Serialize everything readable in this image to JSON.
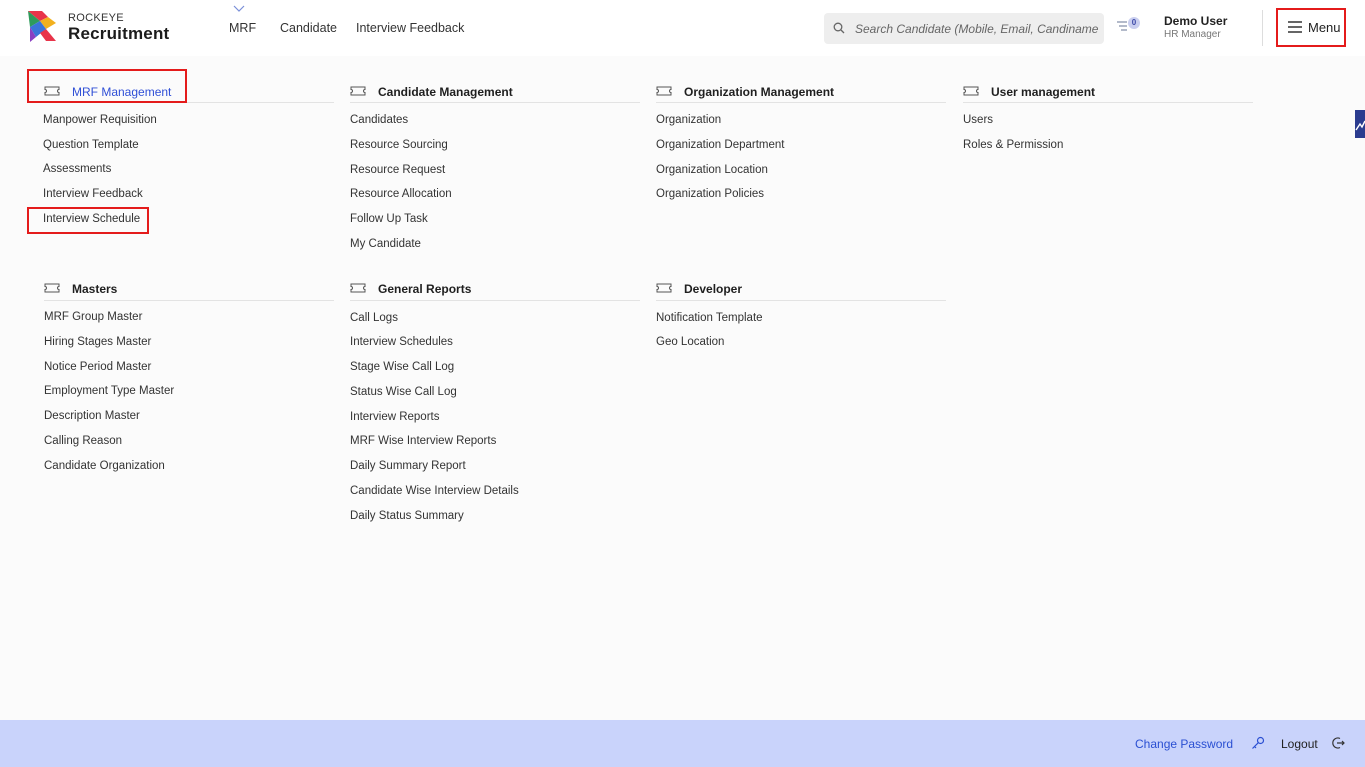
{
  "header": {
    "brand_top": "ROCKEYE",
    "brand_main": "Recruitment",
    "nav": [
      "MRF",
      "Candidate",
      "Interview Feedback"
    ],
    "search_placeholder": "Search Candidate (Mobile, Email, Candiname",
    "notification_count": "0",
    "user_name": "Demo User",
    "user_role": "HR Manager",
    "menu_label": "Menu"
  },
  "sections": {
    "mrf": {
      "title": "MRF Management",
      "items": [
        "Manpower Requisition",
        "Question Template",
        "Assessments",
        "Interview Feedback",
        "Interview Schedule"
      ]
    },
    "candidate": {
      "title": "Candidate Management",
      "items": [
        "Candidates",
        "Resource Sourcing",
        "Resource Request",
        "Resource Allocation",
        "Follow Up Task",
        "My Candidate"
      ]
    },
    "organization": {
      "title": "Organization Management",
      "items": [
        "Organization",
        "Organization Department",
        "Organization Location",
        "Organization Policies"
      ]
    },
    "user": {
      "title": "User management",
      "items": [
        "Users",
        "Roles & Permission"
      ]
    },
    "masters": {
      "title": "Masters",
      "items": [
        "MRF Group Master",
        "Hiring Stages Master",
        "Notice Period Master",
        "Employment Type Master",
        "Description Master",
        "Calling Reason",
        "Candidate Organization"
      ]
    },
    "reports": {
      "title": "General Reports",
      "items": [
        "Call Logs",
        "Interview Schedules",
        "Stage Wise Call Log",
        "Status Wise Call Log",
        "Interview Reports",
        "MRF Wise Interview Reports",
        "Daily Summary Report",
        "Candidate Wise Interview Details",
        "Daily Status Summary"
      ]
    },
    "developer": {
      "title": "Developer",
      "items": [
        "Notification Template",
        "Geo Location"
      ]
    }
  },
  "footer": {
    "change_password": "Change Password",
    "logout": "Logout"
  },
  "colors": {
    "accent": "#2f4fd6",
    "highlight": "#e41b1b",
    "footer_bg": "#c9d3fb"
  }
}
